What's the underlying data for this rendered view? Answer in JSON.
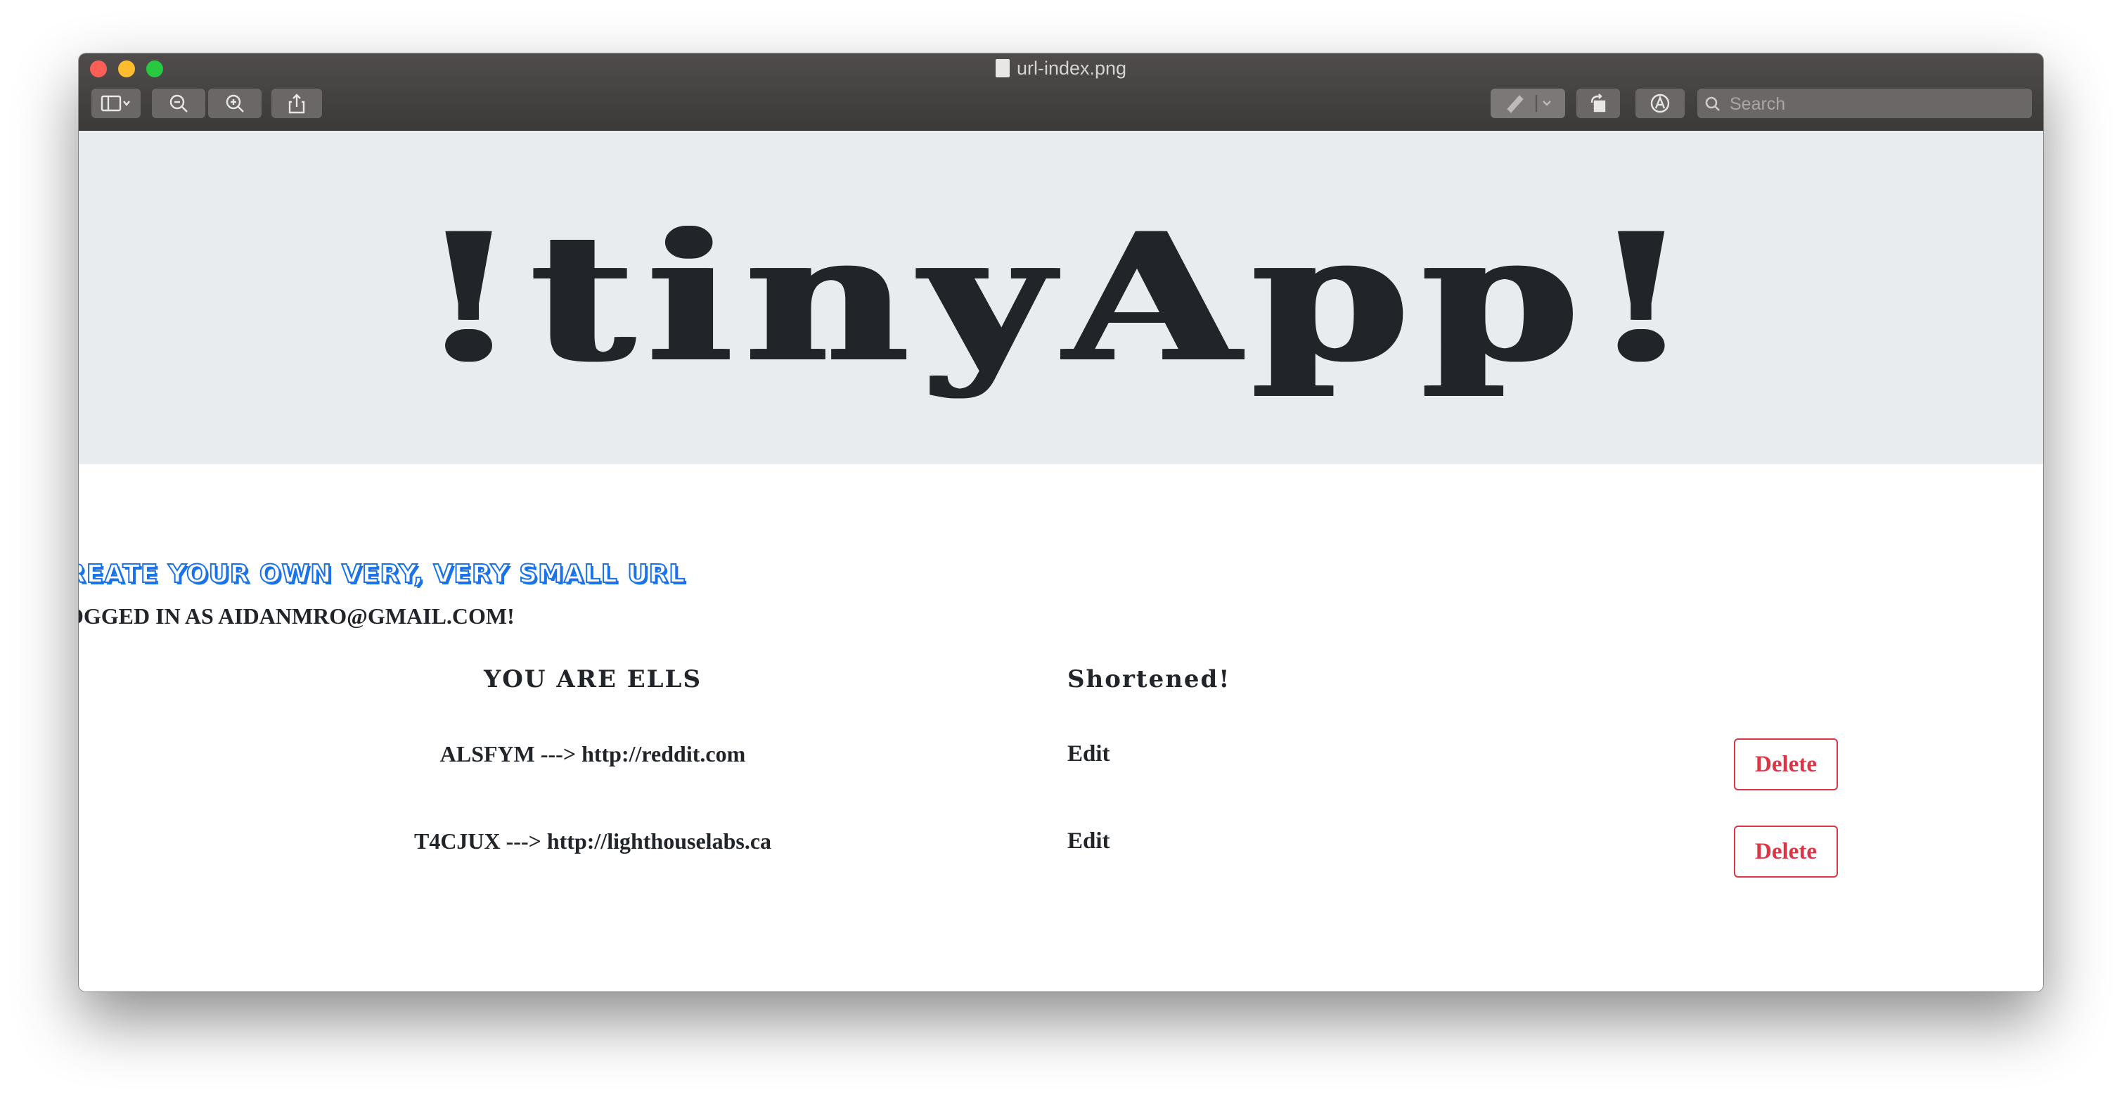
{
  "window": {
    "title": "url-index.png"
  },
  "toolbar": {
    "sidebar_icon": "sidebar-toggle-icon",
    "zoom_out_icon": "zoom-out-icon",
    "zoom_in_icon": "zoom-in-icon",
    "share_icon": "share-icon",
    "markup_icon": "pen-icon",
    "rotate_icon": "rotate-icon",
    "annotate_icon": "markup-icon",
    "search_placeholder": "Search"
  },
  "page": {
    "hero_title": "!tinyApp!",
    "tagline": "REATE YOUR OWN VERY, VERY SMALL URL",
    "logged_in": "OGGED IN AS AIDANMRO@GMAIL.COM!",
    "columns": [
      "YOU ARE ELLS",
      "Shortened!"
    ],
    "rows": [
      {
        "mapping": "ALSFYM ---> http://reddit.com",
        "edit": "Edit",
        "delete": "Delete"
      },
      {
        "mapping": "T4CJUX ---> http://lighthouselabs.ca",
        "edit": "Edit",
        "delete": "Delete"
      }
    ]
  },
  "colors": {
    "accent_blue": "#1a73e8",
    "danger": "#dc3545",
    "jumbotron_bg": "#e9ecef",
    "text": "#212529"
  }
}
